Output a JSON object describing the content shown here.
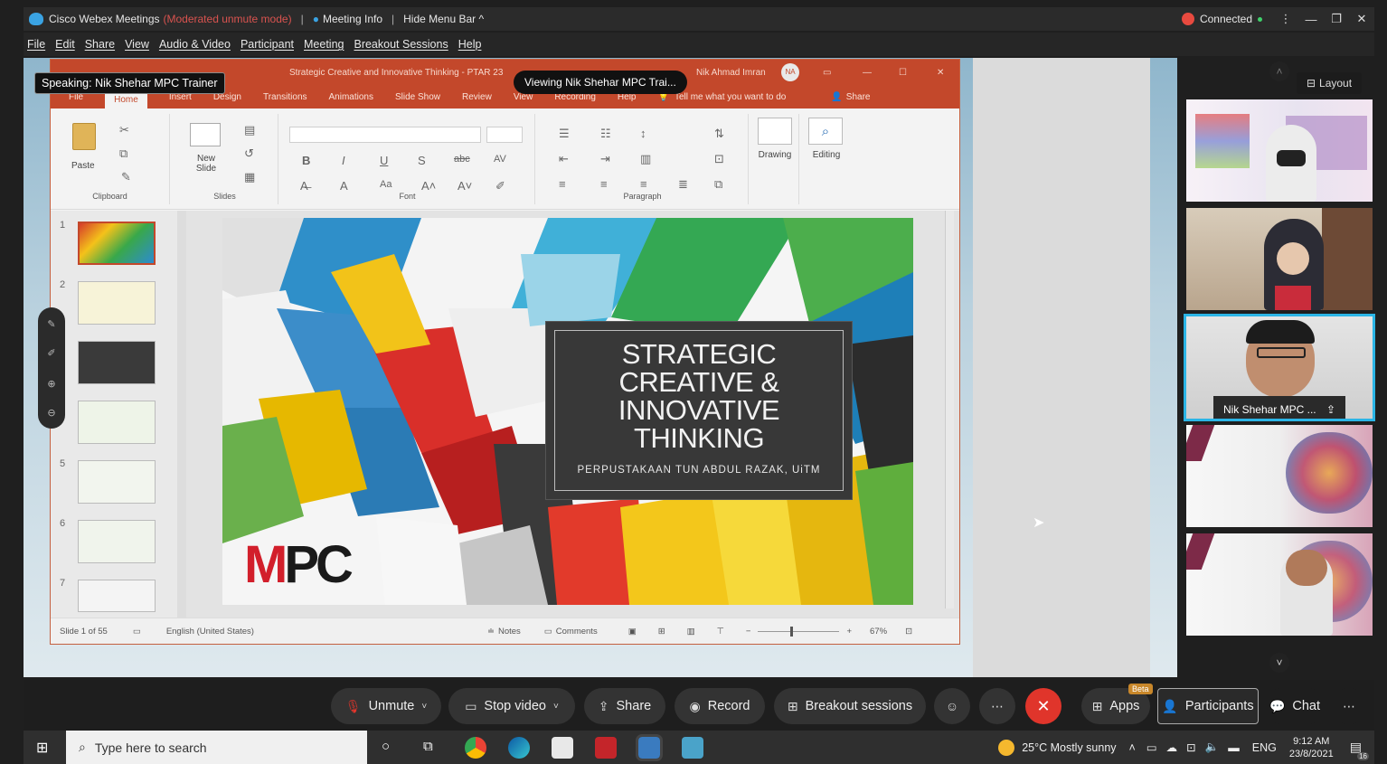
{
  "titlebar": {
    "app": "Cisco Webex Meetings",
    "mode": "(Moderated unmute mode)",
    "meeting_info": "Meeting Info",
    "hide_menu": "Hide Menu Bar ^",
    "status": "Connected"
  },
  "menubar": [
    "File",
    "Edit",
    "Share",
    "View",
    "Audio & Video",
    "Participant",
    "Meeting",
    "Breakout Sessions",
    "Help"
  ],
  "stage": {
    "speaking": "Speaking: Nik Shehar MPC Trainer",
    "viewing": "Viewing Nik Shehar MPC Trai..."
  },
  "ppt": {
    "title": "Strategic Creative and Innovative Thinking - PTAR 23",
    "user": "Nik Ahmad Imran",
    "user_initials": "NA",
    "tabs": [
      "File",
      "Home",
      "Insert",
      "Design",
      "Transitions",
      "Animations",
      "Slide Show",
      "Review",
      "View",
      "Recording",
      "Help"
    ],
    "tell_me": "Tell me what you want to do",
    "share": "Share",
    "groups": {
      "clipboard": "Clipboard",
      "paste": "Paste",
      "slides": "Slides",
      "new_slide": "New Slide",
      "font": "Font",
      "paragraph": "Paragraph",
      "drawing": "Drawing",
      "editing": "Editing"
    },
    "thumb_numbers": [
      "1",
      "2",
      "",
      "",
      "5",
      "6",
      "7"
    ],
    "status": {
      "slide": "Slide 1 of 55",
      "language": "English (United States)",
      "notes": "Notes",
      "comments": "Comments",
      "zoom": "67%"
    }
  },
  "slide": {
    "title": "STRATEGIC\nCREATIVE &\nINNOVATIVE\nTHINKING",
    "subtitle": "PERPUSTAKAAN TUN ABDUL RAZAK, UiTM",
    "logo_m": "M",
    "logo_pc": "PC"
  },
  "right_panel": {
    "layout": "Layout",
    "active_name": "Nik Shehar MPC ..."
  },
  "controls": {
    "unmute": "Unmute",
    "stop_video": "Stop video",
    "share": "Share",
    "record": "Record",
    "breakout": "Breakout sessions",
    "apps": "Apps",
    "beta": "Beta",
    "participants": "Participants",
    "chat": "Chat"
  },
  "taskbar": {
    "search_placeholder": "Type here to search",
    "weather": "25°C  Mostly sunny",
    "lang": "ENG",
    "time": "9:12 AM",
    "date": "23/8/2021",
    "notif": "16"
  },
  "colors": {
    "ppt_accent": "#c3482b",
    "active_tile": "#2bb5e6",
    "end_call": "#e0352b",
    "connected": "#3fd16b"
  }
}
